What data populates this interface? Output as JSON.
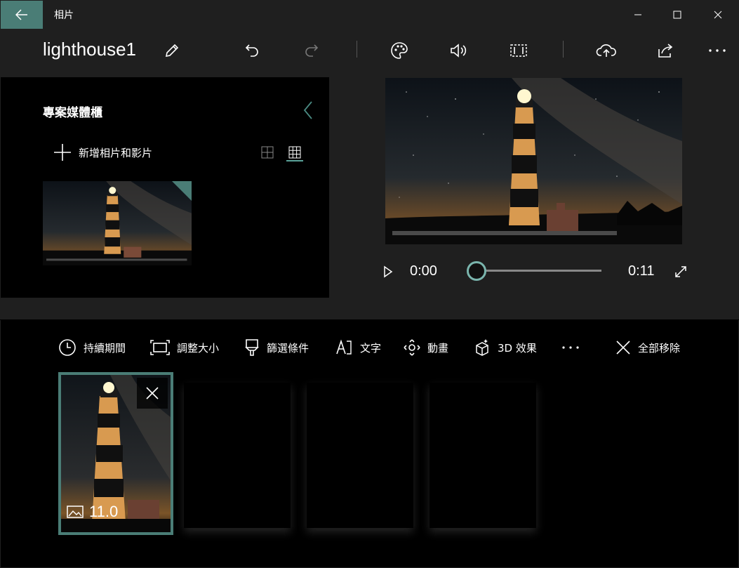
{
  "window": {
    "title": "相片"
  },
  "header": {
    "project_name": "lighthouse1"
  },
  "library": {
    "title": "專案媒體櫃",
    "add_label": "新增相片和影片"
  },
  "player": {
    "current_time": "0:00",
    "total_time": "0:11",
    "progress": 0
  },
  "storyboard": {
    "tools": [
      {
        "label": "持續期間",
        "icon": "clock-icon"
      },
      {
        "label": "調整大小",
        "icon": "resize-icon"
      },
      {
        "label": "篩選條件",
        "icon": "filter-brush-icon"
      },
      {
        "label": "文字",
        "icon": "text-icon"
      },
      {
        "label": "動畫",
        "icon": "motion-icon"
      },
      {
        "label": "3D 效果",
        "icon": "3d-effects-icon"
      },
      {
        "label": "全部移除",
        "icon": "close-icon"
      }
    ],
    "cards": [
      {
        "duration": "11.0",
        "type": "image"
      }
    ]
  },
  "colors": {
    "accent": "#4a7d76",
    "accent_light": "#7ab5ad",
    "background": "#1f1f1f",
    "panel": "#000000"
  }
}
